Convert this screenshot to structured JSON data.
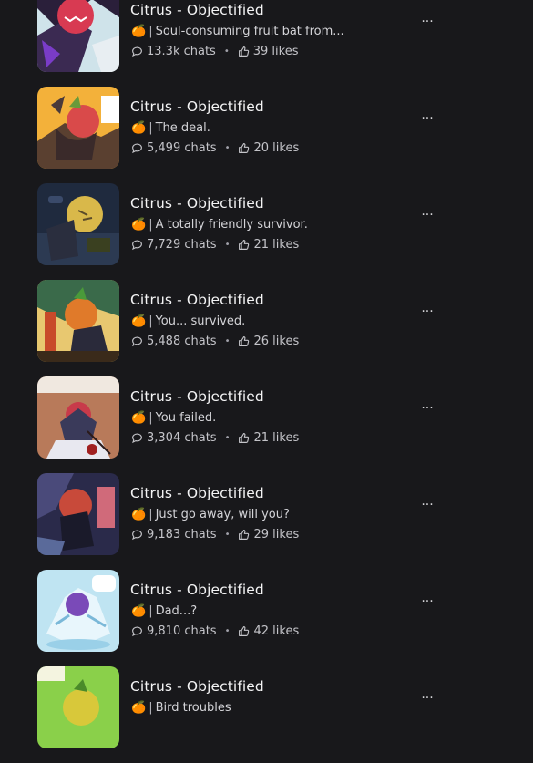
{
  "icons": {
    "emoji": "tangerine-emoji",
    "chats": "chat-bubble-icon",
    "likes": "thumbs-up-icon",
    "more": "ellipsis-icon"
  },
  "separator": "•",
  "more_label": "···",
  "desc_prefix_glyph": "🍊",
  "desc_bar": "|",
  "items": [
    {
      "title": "Citrus - Objectified",
      "description": "Soul-consuming fruit bat from...",
      "chats": "13.3k chats",
      "likes": "39 likes"
    },
    {
      "title": "Citrus - Objectified",
      "description": "The deal.",
      "chats": "5,499 chats",
      "likes": "20 likes"
    },
    {
      "title": "Citrus - Objectified",
      "description": "A totally friendly survivor.",
      "chats": "7,729 chats",
      "likes": "21 likes"
    },
    {
      "title": "Citrus - Objectified",
      "description": "You... survived.",
      "chats": "5,488 chats",
      "likes": "26 likes"
    },
    {
      "title": "Citrus - Objectified",
      "description": "You failed.",
      "chats": "3,304 chats",
      "likes": "21 likes"
    },
    {
      "title": "Citrus - Objectified",
      "description": "Just go away, will you?",
      "chats": "9,183 chats",
      "likes": "29 likes"
    },
    {
      "title": "Citrus - Objectified",
      "description": "Dad...?",
      "chats": "9,810 chats",
      "likes": "42 likes"
    },
    {
      "title": "Citrus - Objectified",
      "description": "Bird troubles",
      "chats": "",
      "likes": ""
    }
  ],
  "colors": {
    "background": "#18181b",
    "title": "#f4f4f5",
    "meta": "#c4c4c9"
  }
}
